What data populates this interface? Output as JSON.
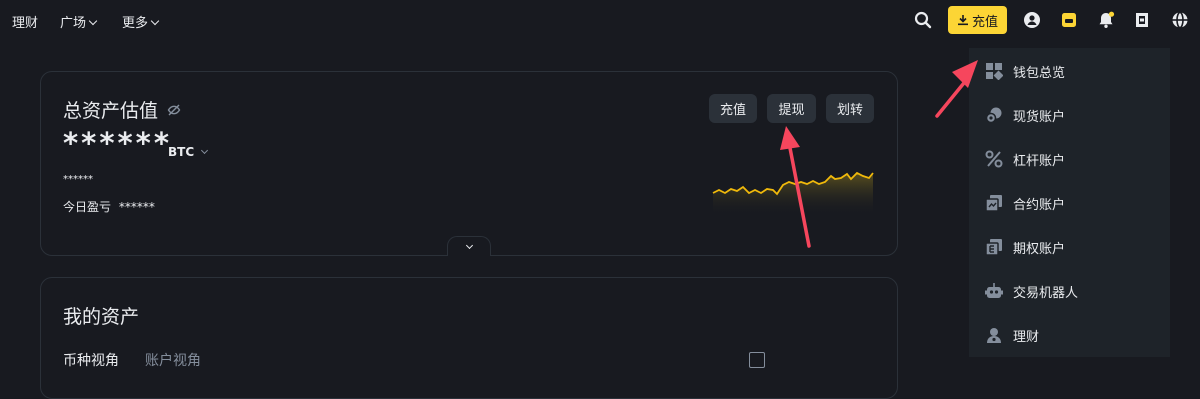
{
  "nav": {
    "items": [
      "理财",
      "广场",
      "更多"
    ]
  },
  "header": {
    "deposit_label": "充值"
  },
  "overview": {
    "title": "总资产估值",
    "hidden_balance": "******",
    "currency": "BTC",
    "hidden_fiat": "******",
    "pnl_label": "今日盈亏",
    "pnl_value": "******",
    "buttons": [
      "充值",
      "提现",
      "划转"
    ]
  },
  "assets": {
    "title": "我的资产",
    "tabs": [
      "币种视角",
      "账户视角"
    ]
  },
  "menu": {
    "items": [
      "钱包总览",
      "现货账户",
      "杠杆账户",
      "合约账户",
      "期权账户",
      "交易机器人",
      "理财"
    ]
  },
  "colors": {
    "background": "#181a20",
    "accent": "#fcd535",
    "annotation": "#f6465d"
  }
}
